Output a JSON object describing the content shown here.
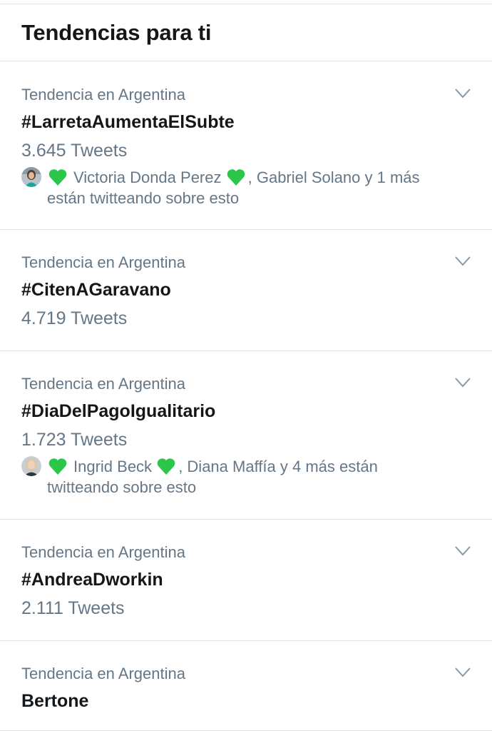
{
  "header": {
    "title": "Tendencias para ti"
  },
  "colors": {
    "text": "#14171a",
    "secondary": "#657786",
    "divider": "#dfe3e6",
    "heart": "#2bc64a"
  },
  "trends": [
    {
      "context": "Tendencia en Argentina",
      "name": "#LarretaAumentaElSubte",
      "count": "3.645 Tweets",
      "social": {
        "name1": "Victoria Donda Perez",
        "rest_line1": ", Gabriel Solano y 1 más",
        "line2": "están twitteando sobre esto"
      }
    },
    {
      "context": "Tendencia en Argentina",
      "name": "#CitenAGaravano",
      "count": "4.719 Tweets"
    },
    {
      "context": "Tendencia en Argentina",
      "name": "#DiaDelPagoIgualitario",
      "count": "1.723 Tweets",
      "social": {
        "name1": "Ingrid Beck",
        "rest_line1": ", Diana Maffía y 4 más están",
        "line2": "twitteando sobre esto"
      }
    },
    {
      "context": "Tendencia en Argentina",
      "name": "#AndreaDworkin",
      "count": "2.111 Tweets"
    },
    {
      "context": "Tendencia en Argentina",
      "name": "Bertone"
    }
  ]
}
